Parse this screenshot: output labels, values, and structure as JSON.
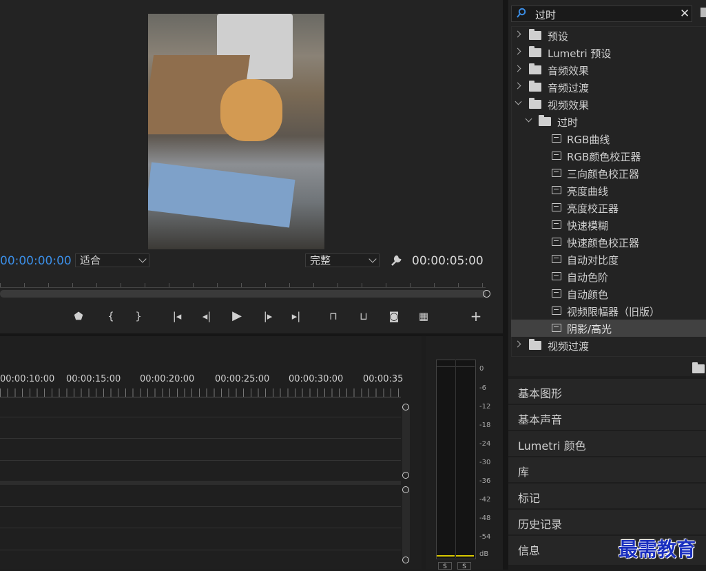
{
  "program_monitor": {
    "current_timecode": "00:00:00:00",
    "zoom_select": "适合",
    "quality_select": "完整",
    "duration_timecode": "00:00:05:00",
    "transport_icons": [
      "add-marker-icon",
      "mark-in-icon",
      "mark-out-icon",
      "go-to-in-icon",
      "step-back-icon",
      "play-icon",
      "step-forward-icon",
      "go-to-out-icon",
      "lift-icon",
      "extract-icon",
      "export-frame-icon",
      "compare-view-icon",
      "add-button-icon"
    ]
  },
  "timeline": {
    "ruler_labels": [
      "00:00:10:00",
      "00:00:15:00",
      "00:00:20:00",
      "00:00:25:00",
      "00:00:30:00",
      "00:00:35"
    ]
  },
  "audio_meter": {
    "db_labels": [
      "0",
      "-6",
      "-12",
      "-18",
      "-24",
      "-30",
      "-36",
      "-42",
      "-48",
      "-54",
      "dB"
    ],
    "solo_labels": [
      "S",
      "S"
    ]
  },
  "effects_panel": {
    "search_value": "过时",
    "tree": [
      {
        "label": "预设",
        "type": "preset-folder",
        "expanded": false,
        "level": 0
      },
      {
        "label": "Lumetri 预设",
        "type": "preset-folder",
        "expanded": false,
        "level": 0
      },
      {
        "label": "音频效果",
        "type": "folder",
        "expanded": false,
        "level": 0
      },
      {
        "label": "音频过渡",
        "type": "folder",
        "expanded": false,
        "level": 0
      },
      {
        "label": "视频效果",
        "type": "folder",
        "expanded": true,
        "level": 0
      },
      {
        "label": "过时",
        "type": "folder",
        "expanded": true,
        "level": 1
      },
      {
        "label": "RGB曲线",
        "type": "effect",
        "level": 2
      },
      {
        "label": "RGB颜色校正器",
        "type": "effect",
        "level": 2
      },
      {
        "label": "三向颜色校正器",
        "type": "effect",
        "level": 2
      },
      {
        "label": "亮度曲线",
        "type": "effect",
        "level": 2
      },
      {
        "label": "亮度校正器",
        "type": "effect",
        "level": 2
      },
      {
        "label": "快速模糊",
        "type": "effect",
        "level": 2
      },
      {
        "label": "快速颜色校正器",
        "type": "effect",
        "level": 2
      },
      {
        "label": "自动对比度",
        "type": "effect",
        "level": 2
      },
      {
        "label": "自动色阶",
        "type": "effect",
        "level": 2
      },
      {
        "label": "自动颜色",
        "type": "effect",
        "level": 2
      },
      {
        "label": "视频限幅器（旧版）",
        "type": "effect",
        "level": 2
      },
      {
        "label": "阴影/高光",
        "type": "effect",
        "level": 2,
        "selected": true
      },
      {
        "label": "视频过渡",
        "type": "folder",
        "expanded": false,
        "level": 0
      }
    ]
  },
  "side_panels": [
    "基本图形",
    "基本声音",
    "Lumetri 颜色",
    "库",
    "标记",
    "历史记录",
    "信息"
  ],
  "watermark": "最需教育",
  "colors": {
    "accent_blue": "#3b8ee6",
    "watermark_blue": "#1a2fbf",
    "meter_yellow": "#d8c800"
  }
}
